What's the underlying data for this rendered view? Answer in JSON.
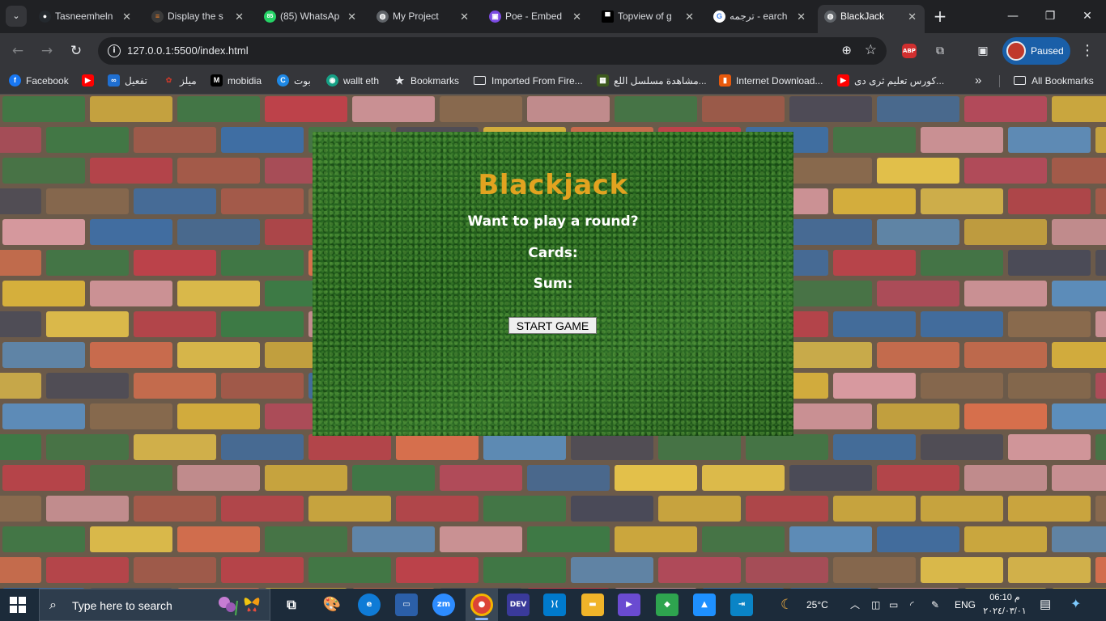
{
  "browser": {
    "tabs": [
      {
        "title": "Tasneemheln",
        "icon": "github-icon",
        "color": "#ffffff"
      },
      {
        "title": "Display the s",
        "icon": "stack-icon",
        "color": "#f48024"
      },
      {
        "title": "(85) WhatsAp",
        "icon": "whatsapp-icon",
        "color": "#25d366"
      },
      {
        "title": "My Project",
        "icon": "globe-icon",
        "color": "#9aa0a6"
      },
      {
        "title": "Poe - Embed",
        "icon": "poe-icon",
        "color": "#7b4ae2"
      },
      {
        "title": "Topview of g",
        "icon": "square-icon",
        "color": "#111111"
      },
      {
        "title": "ترجمه - earch",
        "icon": "google-icon",
        "color": "#4285f4"
      },
      {
        "title": "BlackJack",
        "icon": "globe-icon",
        "color": "#9aa0a6",
        "active": true
      }
    ],
    "url": "127.0.0.1:5500/index.html",
    "profile_label": "Paused",
    "abp_label": "ABP"
  },
  "bookmarks": [
    {
      "label": "Facebook",
      "icon": "facebook-icon",
      "color": "#1877f2"
    },
    {
      "label": "",
      "icon": "youtube-icon",
      "color": "#ff0000"
    },
    {
      "label": "تفعيل",
      "icon": "infinity-icon",
      "color": "#1f6fd1"
    },
    {
      "label": "ميلز",
      "icon": "meals-icon",
      "color": "#b22222"
    },
    {
      "label": "mobidia",
      "icon": "m-icon",
      "color": "#000000"
    },
    {
      "label": "بوت",
      "icon": "c-icon",
      "color": "#1e88e5"
    },
    {
      "label": "wallt eth",
      "icon": "wallet-icon",
      "color": "#16a085"
    },
    {
      "label": "Bookmarks",
      "icon": "star-icon",
      "color": "#e8eaed"
    },
    {
      "label": "Imported From Fire...",
      "icon": "folder-icon",
      "color": "#e8eaed"
    },
    {
      "label": "مشاهدة مسلسل اللع...",
      "icon": "tv-icon",
      "color": "#3d5a1e"
    },
    {
      "label": "Internet Download...",
      "icon": "idm-icon",
      "color": "#e8590c"
    },
    {
      "label": "كورس تعليم ثرى دى...",
      "icon": "youtube-icon",
      "color": "#ff0000"
    },
    {
      "label": "All Bookmarks",
      "icon": "folder-icon",
      "color": "#e8eaed"
    }
  ],
  "game": {
    "title": "Blackjack",
    "message": "Want to play a round?",
    "cards_label": "Cards:",
    "sum_label": "Sum:",
    "start_button": "START GAME",
    "title_color": "#e2a320"
  },
  "taskbar": {
    "search_placeholder": "Type here to search",
    "weather": "25°C",
    "language": "ENG",
    "time": "06:10 م",
    "date": "٢٠٢٤/٠٣/٠١"
  }
}
